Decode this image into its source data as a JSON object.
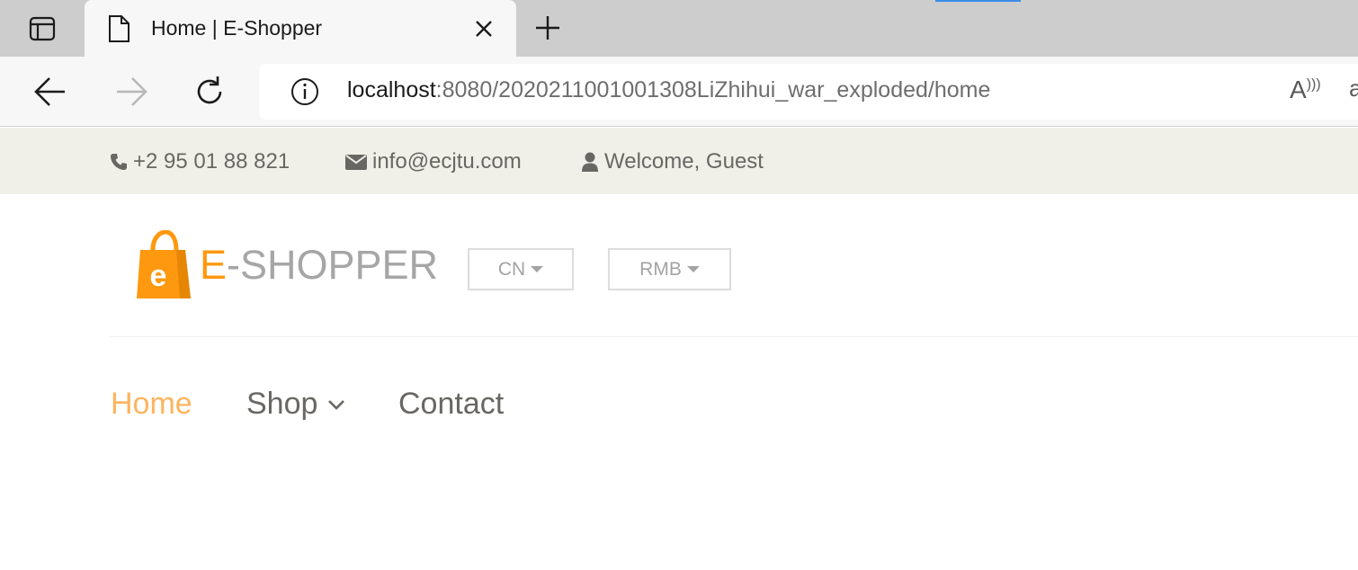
{
  "browser": {
    "tab": {
      "title": "Home | E-Shopper"
    },
    "address": {
      "host": "localhost",
      "rest": ":8080/2020211001001308LiZhihui_war_exploded/home"
    },
    "read_aloud": "A",
    "cut_char": "a",
    "accent_color": "#3a8ee6"
  },
  "header_top": {
    "phone": "+2 95 01 88 821",
    "email": "info@ecjtu.com",
    "welcome": "Welcome, Guest"
  },
  "logo": {
    "e": "E",
    "rest": "-SHOPPER",
    "bag_letter": "e",
    "brand_color": "#fe980f"
  },
  "dropdowns": {
    "language": "CN",
    "currency": "RMB"
  },
  "menu": {
    "items": [
      {
        "label": "Home",
        "active": true
      },
      {
        "label": "Shop",
        "has_dropdown": true
      },
      {
        "label": "Contact"
      }
    ],
    "active_color": "#fdb45e"
  },
  "icons": {
    "sidebar": "sidebar-panel-icon",
    "page": "page-icon",
    "close": "close-icon",
    "new_tab": "plus-icon",
    "back": "back-arrow-icon",
    "forward": "forward-arrow-icon",
    "refresh": "refresh-icon",
    "info": "info-icon",
    "phone": "phone-icon",
    "email": "envelope-icon",
    "user": "user-icon",
    "chevron": "chevron-down-icon"
  }
}
